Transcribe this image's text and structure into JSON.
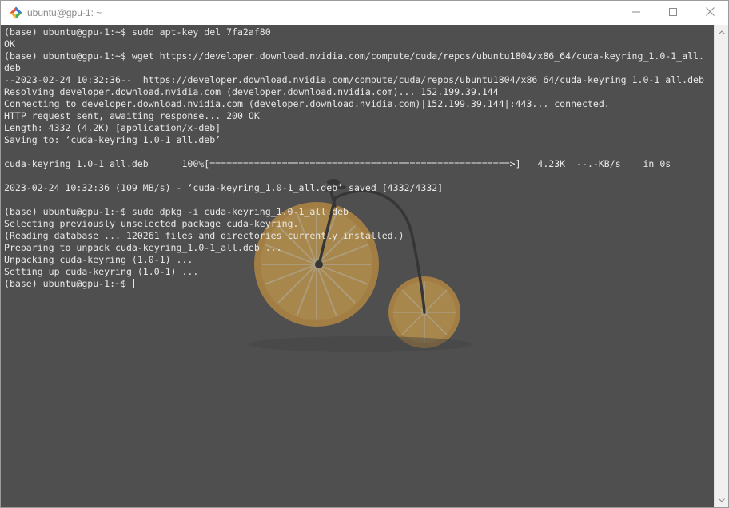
{
  "window": {
    "title": "ubuntu@gpu-1: ~",
    "icons": {
      "app": "git-bash-diamond-icon",
      "minimize": "minimize-icon",
      "maximize": "maximize-icon",
      "close": "close-icon"
    }
  },
  "terminal": {
    "background_color": "#4f4f4f",
    "text_color": "#e8e8e8",
    "lines": [
      "(base) ubuntu@gpu-1:~$ sudo apt-key del 7fa2af80",
      "OK",
      "(base) ubuntu@gpu-1:~$ wget https://developer.download.nvidia.com/compute/cuda/repos/ubuntu1804/x86_64/cuda-keyring_1.0-1_all.",
      "deb",
      "--2023-02-24 10:32:36--  https://developer.download.nvidia.com/compute/cuda/repos/ubuntu1804/x86_64/cuda-keyring_1.0-1_all.deb",
      "Resolving developer.download.nvidia.com (developer.download.nvidia.com)... 152.199.39.144",
      "Connecting to developer.download.nvidia.com (developer.download.nvidia.com)|152.199.39.144|:443... connected.",
      "HTTP request sent, awaiting response... 200 OK",
      "Length: 4332 (4.2K) [application/x-deb]",
      "Saving to: ‘cuda-keyring_1.0-1_all.deb’",
      "",
      "cuda-keyring_1.0-1_all.deb      100%[======================================================>]   4.23K  --.-KB/s    in 0s",
      "",
      "2023-02-24 10:32:36 (109 MB/s) - ‘cuda-keyring_1.0-1_all.deb’ saved [4332/4332]",
      "",
      "(base) ubuntu@gpu-1:~$ sudo dpkg -i cuda-keyring_1.0-1_all.deb",
      "Selecting previously unselected package cuda-keyring.",
      "(Reading database ... 120261 files and directories currently installed.)",
      "Preparing to unpack cuda-keyring_1.0-1_all.deb ...",
      "Unpacking cuda-keyring (1.0-1) ...",
      "Setting up cuda-keyring (1.0-1) ...",
      "(base) ubuntu@gpu-1:~$ "
    ],
    "background_art": "penny-farthing-orange-wheels-wallpaper"
  },
  "scrollbar": {
    "up_icon": "scroll-up-arrow-icon",
    "down_icon": "scroll-down-arrow-icon"
  }
}
